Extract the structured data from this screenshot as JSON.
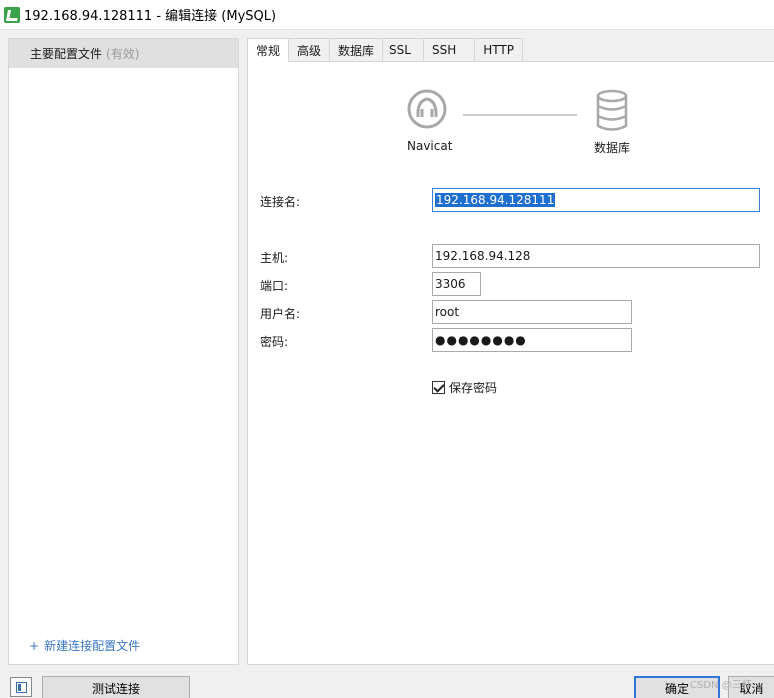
{
  "window": {
    "title": "192.168.94.128111 - 编辑连接 (MySQL)"
  },
  "sidebar": {
    "profile_name": "主要配置文件",
    "profile_status": "(有效)",
    "new_profile_label": "新建连接配置文件",
    "new_profile_plus": "+"
  },
  "tabs": [
    {
      "label": "常规"
    },
    {
      "label": "高级"
    },
    {
      "label": "数据库"
    },
    {
      "label": "SSL"
    },
    {
      "label": "SSH"
    },
    {
      "label": "HTTP"
    }
  ],
  "diagram": {
    "source_label": "Navicat",
    "target_label": "数据库"
  },
  "form": {
    "connection_name_label": "连接名:",
    "connection_name_value": "192.168.94.128111",
    "host_label": "主机:",
    "host_value": "192.168.94.128",
    "port_label": "端口:",
    "port_value": "3306",
    "username_label": "用户名:",
    "username_value": "root",
    "password_label": "密码:",
    "password_value": "●●●●●●●●",
    "save_password_label": "保存密码",
    "save_password_checked": true
  },
  "footer": {
    "test_button": "测试连接",
    "ok_button": "确定",
    "cancel_button": "取消",
    "watermark": "CSDN @三杯"
  },
  "colors": {
    "accent": "#1f6fd1",
    "link": "#3c78c6",
    "logo_gray": "#a8a8a8",
    "app_icon": "#3aa34a"
  }
}
